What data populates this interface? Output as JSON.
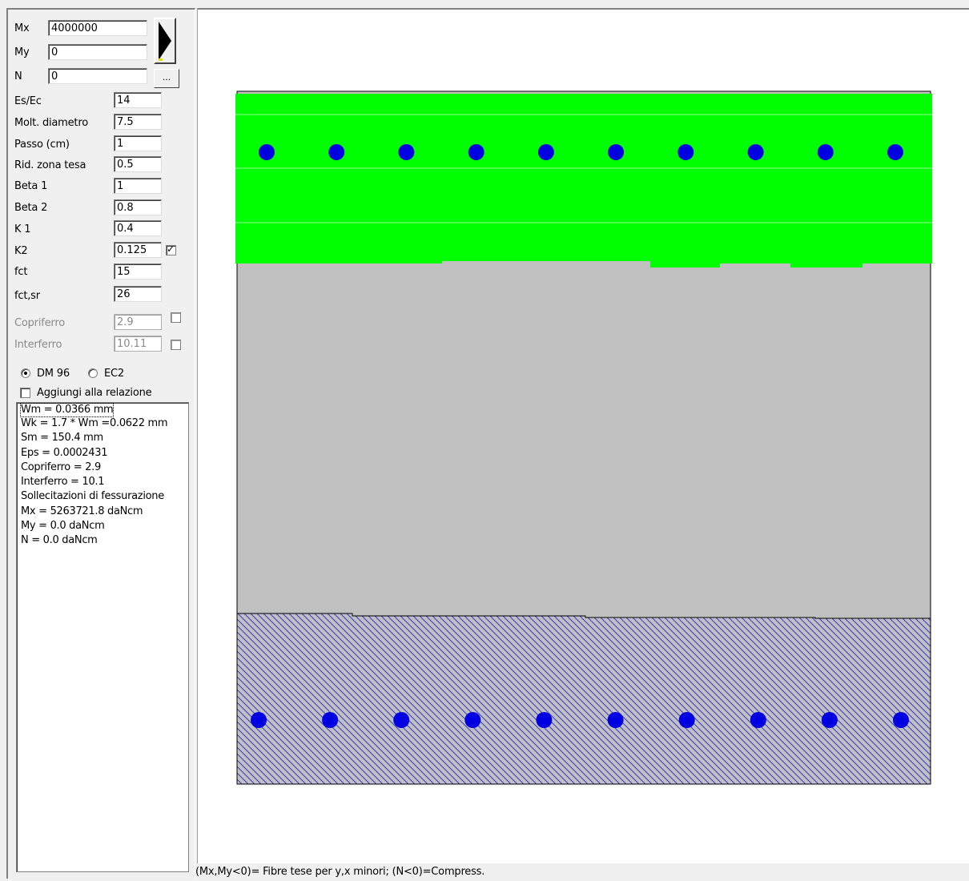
{
  "inputs": {
    "mx": {
      "label": "Mx",
      "value": "4000000"
    },
    "my": {
      "label": "My",
      "value": "0"
    },
    "n": {
      "label": "N",
      "value": "0"
    }
  },
  "dots_button": "...",
  "params": [
    {
      "label": "Es/Ec",
      "value": "14"
    },
    {
      "label": "Molt. diametro",
      "value": "7.5"
    },
    {
      "label": "Passo (cm)",
      "value": "1"
    },
    {
      "label": "Rid. zona tesa",
      "value": "0.5"
    },
    {
      "label": "Beta 1",
      "value": "1"
    },
    {
      "label": "Beta 2",
      "value": "0.8"
    },
    {
      "label": "K 1",
      "value": "0.4"
    },
    {
      "label": "K2",
      "value": "0.125"
    },
    {
      "label": "fct",
      "value": "15"
    },
    {
      "label": "fct,sr",
      "value": "26"
    },
    {
      "label": "Copriferro",
      "value": "2.9"
    },
    {
      "label": "Interferro",
      "value": "10.11"
    }
  ],
  "checkboxes": {
    "k2_checked": true,
    "copriferro_checked": false,
    "interferro_checked": false
  },
  "norm": {
    "dm96_label": "DM 96",
    "ec2_label": "EC2",
    "selected": "DM 96"
  },
  "add_to_report": {
    "label": "Aggiungi alla relazione",
    "checked": false
  },
  "results": [
    "Wm = 0.0366 mm",
    "Wk = 1.7 * Wm =0.0622 mm",
    "Sm = 150.4 mm",
    "Eps = 0.0002431",
    "Copriferro = 2.9",
    "Interferro = 10.1",
    "Sollecitazioni di fessurazione",
    "Mx = 5263721.8 daNcm",
    "My = 0.0 daNcm",
    "N = 0.0 daNcm"
  ],
  "status": "(Mx,My<0)= Fibre tese per y,x minori; (N<0)=Compress.",
  "section": {
    "top_bar_count": 10,
    "bottom_bar_count": 10,
    "colors": {
      "compressed_zone": "#00ff00",
      "section_fill": "#c0c0c0",
      "hatch_lines": "#3a3ad0",
      "bars": "#0000e0",
      "outline": "#000000"
    }
  }
}
